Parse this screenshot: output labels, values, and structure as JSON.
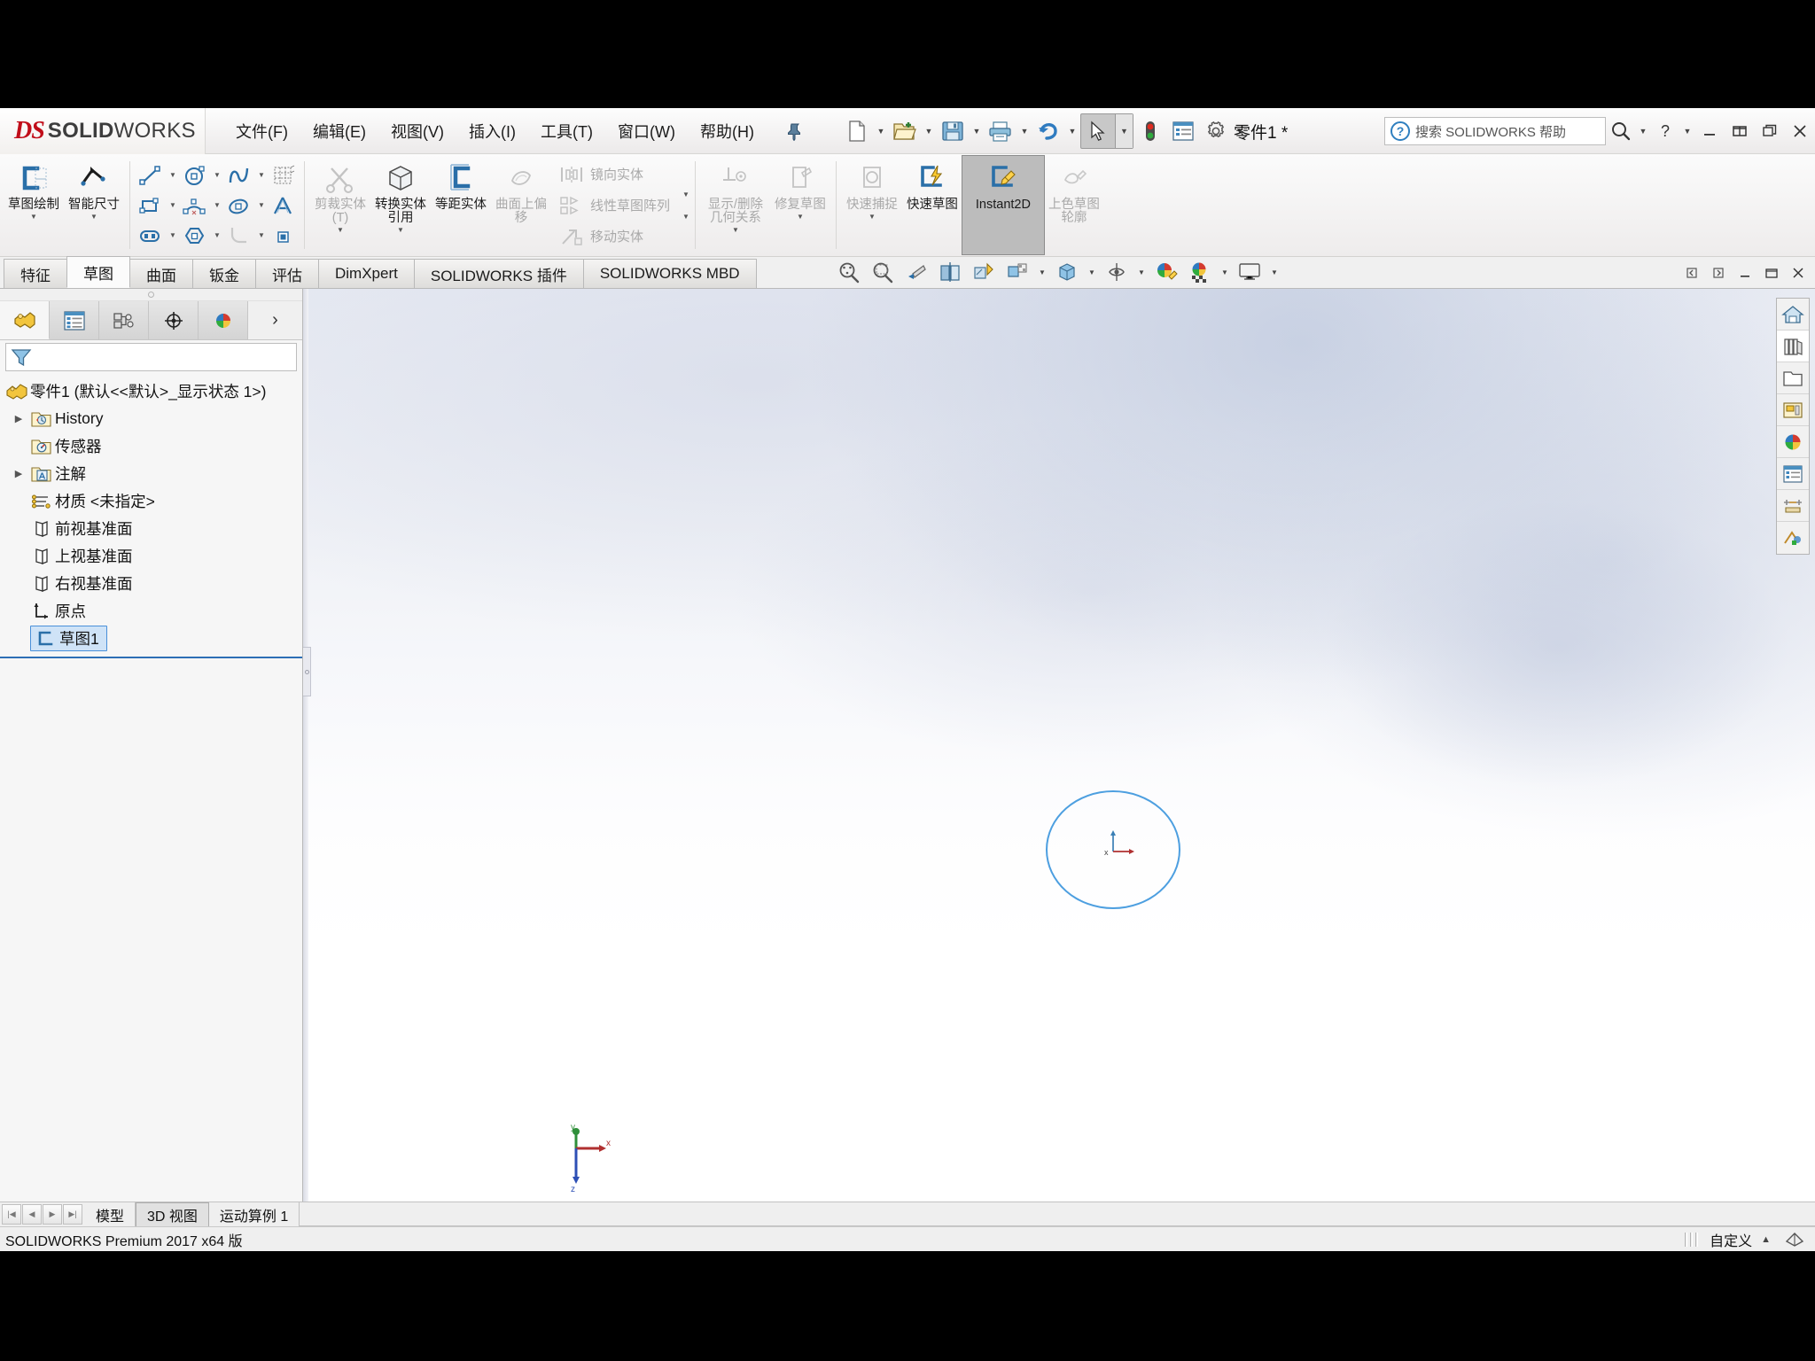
{
  "app": {
    "brand_ds": "DS",
    "brand_main": "SOLID",
    "brand_light": "WORKS",
    "document_title": "零件1 *",
    "product_version": "SOLIDWORKS Premium 2017 x64 版",
    "accent_blue": "#4d9fe0",
    "brand_red": "#c10e1a"
  },
  "menu": {
    "items": [
      {
        "label": "文件(F)",
        "name": "menu-file"
      },
      {
        "label": "编辑(E)",
        "name": "menu-edit"
      },
      {
        "label": "视图(V)",
        "name": "menu-view"
      },
      {
        "label": "插入(I)",
        "name": "menu-insert"
      },
      {
        "label": "工具(T)",
        "name": "menu-tools"
      },
      {
        "label": "窗口(W)",
        "name": "menu-window"
      },
      {
        "label": "帮助(H)",
        "name": "menu-help"
      }
    ],
    "pin_icon": "pushpin-icon"
  },
  "quick_access": [
    {
      "name": "new-document-button",
      "icon": "new-file-icon",
      "has_arrow": true
    },
    {
      "name": "open-document-button",
      "icon": "open-folder-icon",
      "has_arrow": true
    },
    {
      "name": "save-button",
      "icon": "floppy-save-icon",
      "has_arrow": true
    },
    {
      "name": "print-button",
      "icon": "printer-icon",
      "has_arrow": true
    },
    {
      "name": "undo-button",
      "icon": "undo-arrow-icon",
      "has_arrow": true
    },
    {
      "name": "select-tool-button",
      "icon": "mouse-cursor-icon",
      "has_arrow": true,
      "selected": true
    },
    {
      "name": "rebuild-button",
      "icon": "traffic-light-icon",
      "has_arrow": false
    },
    {
      "name": "file-properties-button",
      "icon": "properties-list-icon",
      "has_arrow": false
    },
    {
      "name": "options-button",
      "icon": "gear-icon",
      "has_arrow": true
    }
  ],
  "search": {
    "placeholder": "搜索 SOLIDWORKS 帮助",
    "value": "",
    "help_icon": "question-circle-icon",
    "magnifier_icon": "magnifier-icon"
  },
  "window_controls": {
    "help": "?",
    "minimize": "minimize-icon",
    "restore": "restore-icon",
    "maximize": "maximize-icon",
    "close": "close-icon"
  },
  "ribbon": {
    "group_sketch": [
      {
        "label": "草图绘制",
        "name": "sketch-draw-button",
        "icon": "sketch-icon",
        "disabled": false,
        "caret": true
      },
      {
        "label": "智能尺寸",
        "name": "smart-dimension-button",
        "icon": "smart-dimension-icon",
        "disabled": false,
        "caret": true
      }
    ],
    "group_entities": [
      {
        "name": "line-tool",
        "icon": "line-icon",
        "caret": true
      },
      {
        "name": "circle-tool",
        "icon": "circle-icon",
        "caret": true
      },
      {
        "name": "spline-tool",
        "icon": "spline-icon",
        "caret": true
      },
      {
        "name": "sketch-pattern-tool",
        "icon": "grid-pattern-icon",
        "caret": false
      },
      {
        "name": "rectangle-tool",
        "icon": "rectangle-icon",
        "caret": true
      },
      {
        "name": "arc-tool",
        "icon": "arc-icon",
        "caret": true
      },
      {
        "name": "ellipse-tool",
        "icon": "ellipse-icon",
        "caret": true
      },
      {
        "name": "text-tool",
        "icon": "text-a-icon",
        "caret": false
      },
      {
        "name": "slot-tool",
        "icon": "slot-icon",
        "caret": true
      },
      {
        "name": "polygon-tool",
        "icon": "polygon-icon",
        "caret": false
      },
      {
        "name": "fillet-tool",
        "icon": "sketch-fillet-icon",
        "caret": true
      },
      {
        "name": "point-tool",
        "icon": "point-icon",
        "caret": false
      }
    ],
    "group_modify": [
      {
        "label": "剪裁实体(T)",
        "name": "trim-entities-button",
        "icon": "trim-icon",
        "disabled": true,
        "caret": true
      },
      {
        "label": "转换实体引用",
        "name": "convert-entities-button",
        "icon": "convert-entities-icon",
        "disabled": false,
        "caret": true
      },
      {
        "label": "等距实体",
        "name": "offset-entities-button",
        "icon": "offset-entities-icon",
        "disabled": false,
        "caret": false
      },
      {
        "label": "曲面上偏移",
        "name": "offset-on-surface-button",
        "icon": "offset-surface-icon",
        "disabled": true,
        "caret": false
      }
    ],
    "group_pattern": [
      {
        "label": "镜向实体",
        "name": "mirror-entities-button",
        "icon": "mirror-icon",
        "disabled": true
      },
      {
        "label": "线性草图阵列",
        "name": "linear-sketch-pattern-button",
        "icon": "linear-pattern-icon",
        "disabled": true
      },
      {
        "label": "移动实体",
        "name": "move-entities-button",
        "icon": "move-entities-icon",
        "disabled": true
      }
    ],
    "group_relations": [
      {
        "label": "显示/删除几何关系",
        "name": "display-delete-relations-button",
        "icon": "relations-icon",
        "disabled": true,
        "caret": true
      },
      {
        "label": "修复草图",
        "name": "repair-sketch-button",
        "icon": "repair-sketch-icon",
        "disabled": true,
        "caret": false
      }
    ],
    "group_tools": [
      {
        "label": "快速捕捉",
        "name": "quick-snaps-button",
        "icon": "quick-snap-icon",
        "disabled": true,
        "caret": true
      },
      {
        "label": "快速草图",
        "name": "rapid-sketch-button",
        "icon": "rapid-sketch-icon",
        "disabled": false,
        "caret": false
      },
      {
        "label": "Instant2D",
        "name": "instant2d-button",
        "icon": "instant2d-icon",
        "disabled": false,
        "caret": false,
        "active": true
      },
      {
        "label": "上色草图轮廓",
        "name": "shaded-sketch-contours-button",
        "icon": "shaded-contour-icon",
        "disabled": true,
        "caret": false
      }
    ]
  },
  "command_tabs": {
    "selected": "草图",
    "items": [
      {
        "label": "特征",
        "name": "tab-features"
      },
      {
        "label": "草图",
        "name": "tab-sketch"
      },
      {
        "label": "曲面",
        "name": "tab-surfaces"
      },
      {
        "label": "钣金",
        "name": "tab-sheet-metal"
      },
      {
        "label": "评估",
        "name": "tab-evaluate"
      },
      {
        "label": "DimXpert",
        "name": "tab-dimxpert"
      },
      {
        "label": "SOLIDWORKS 插件",
        "name": "tab-solidworks-addins"
      },
      {
        "label": "SOLIDWORKS MBD",
        "name": "tab-solidworks-mbd"
      }
    ]
  },
  "view_toolbar": [
    {
      "name": "zoom-to-fit-button",
      "icon": "zoom-fit-icon",
      "caret": false
    },
    {
      "name": "zoom-to-area-button",
      "icon": "zoom-area-icon",
      "caret": false
    },
    {
      "name": "previous-view-button",
      "icon": "previous-view-icon",
      "caret": false
    },
    {
      "name": "section-view-button",
      "icon": "section-view-icon",
      "caret": false
    },
    {
      "name": "view-orientation-button",
      "icon": "view-orientation-icon",
      "caret": false
    },
    {
      "name": "display-style-button",
      "icon": "display-style-icon",
      "caret": true
    },
    {
      "name": "view-settings-button",
      "icon": "view-settings-cube-icon",
      "caret": true
    },
    {
      "name": "hide-show-items-button",
      "icon": "hide-show-eye-icon",
      "caret": true
    },
    {
      "name": "apply-scene-button",
      "icon": "apply-scene-icon",
      "caret": false
    },
    {
      "name": "view-setting-palette-button",
      "icon": "scene-palette-icon",
      "caret": true
    },
    {
      "name": "viewport-button",
      "icon": "monitor-viewport-icon",
      "caret": true
    }
  ],
  "doc_window_controls": {
    "prev": "◄",
    "next": "►",
    "minimize": "–",
    "restore": "❐",
    "close": "✕"
  },
  "feature_manager": {
    "tabs": [
      {
        "name": "feature-manager-tab",
        "icon": "feature-tree-icon",
        "selected": true
      },
      {
        "name": "property-manager-tab",
        "icon": "property-list-icon",
        "selected": false
      },
      {
        "name": "configuration-manager-tab",
        "icon": "configuration-icon",
        "selected": false
      },
      {
        "name": "dimxpert-manager-tab",
        "icon": "dimxpert-target-icon",
        "selected": false
      },
      {
        "name": "display-manager-tab",
        "icon": "display-palette-icon",
        "selected": false
      }
    ],
    "more_icon": "chevron-right-icon",
    "filter": {
      "placeholder": "",
      "value": "",
      "icon": "filter-funnel-icon"
    },
    "tree": [
      {
        "label": "零件1  (默认<<默认>_显示状态 1>)",
        "name": "tree-node-part",
        "icon": "part-icon",
        "indent": 0,
        "expander": "none",
        "selected": false
      },
      {
        "label": "History",
        "name": "tree-node-history",
        "icon": "history-folder-icon",
        "indent": 1,
        "expander": "collapsed",
        "selected": false
      },
      {
        "label": "传感器",
        "name": "tree-node-sensors",
        "icon": "sensor-folder-icon",
        "indent": 1,
        "expander": "none",
        "selected": false
      },
      {
        "label": "注解",
        "name": "tree-node-annotations",
        "icon": "annotation-folder-icon",
        "indent": 1,
        "expander": "collapsed",
        "selected": false
      },
      {
        "label": "材质 <未指定>",
        "name": "tree-node-material",
        "icon": "material-icon",
        "indent": 1,
        "expander": "none",
        "selected": false
      },
      {
        "label": "前视基准面",
        "name": "tree-node-front-plane",
        "icon": "plane-icon",
        "indent": 1,
        "expander": "none",
        "selected": false
      },
      {
        "label": "上视基准面",
        "name": "tree-node-top-plane",
        "icon": "plane-icon",
        "indent": 1,
        "expander": "none",
        "selected": false
      },
      {
        "label": "右视基准面",
        "name": "tree-node-right-plane",
        "icon": "plane-icon",
        "indent": 1,
        "expander": "none",
        "selected": false
      },
      {
        "label": "原点",
        "name": "tree-node-origin",
        "icon": "origin-icon",
        "indent": 1,
        "expander": "none",
        "selected": false
      },
      {
        "label": "草图1",
        "name": "tree-node-sketch1",
        "icon": "sketch-node-icon",
        "indent": 1,
        "expander": "none",
        "selected": true
      }
    ]
  },
  "graphics": {
    "sketch_entity": "circle",
    "triad_axes": {
      "x": "x",
      "y": "y",
      "z": "z"
    },
    "origin_axes": {
      "x": "x",
      "y": "y"
    }
  },
  "right_toolbar": [
    {
      "name": "view-home-button",
      "icon": "home-icon"
    },
    {
      "name": "task-pane-design-library-button",
      "icon": "design-library-icon"
    },
    {
      "name": "file-explorer-button",
      "icon": "folder-icon"
    },
    {
      "name": "view-palette-button",
      "icon": "view-palette-icon"
    },
    {
      "name": "appearances-scenes-button",
      "icon": "appearances-sphere-icon"
    },
    {
      "name": "custom-properties-button",
      "icon": "custom-properties-icon"
    },
    {
      "name": "solidworks-forum-button",
      "icon": "forum-icon"
    },
    {
      "name": "solidworks-resources-button",
      "icon": "resources-icon"
    }
  ],
  "bottom_tabs": {
    "selected": "3D 视图",
    "items": [
      {
        "label": "模型",
        "name": "bottom-tab-model"
      },
      {
        "label": "3D 视图",
        "name": "bottom-tab-3d-views"
      },
      {
        "label": "运动算例 1",
        "name": "bottom-tab-motion-study-1"
      }
    ],
    "nav": [
      {
        "name": "first-tab-button",
        "icon": "first-icon",
        "glyph": "|◀"
      },
      {
        "name": "prev-tab-button",
        "icon": "previous-icon",
        "glyph": "◀"
      },
      {
        "name": "next-tab-button",
        "icon": "next-icon",
        "glyph": "▶"
      },
      {
        "name": "last-tab-button",
        "icon": "last-icon",
        "glyph": "▶|"
      }
    ]
  },
  "status_bar": {
    "left_text": "SOLIDWORKS Premium 2017 x64 版",
    "customize_label": "自定义",
    "customize_caret": "▲",
    "overlay_icon": "overlay-icon"
  }
}
